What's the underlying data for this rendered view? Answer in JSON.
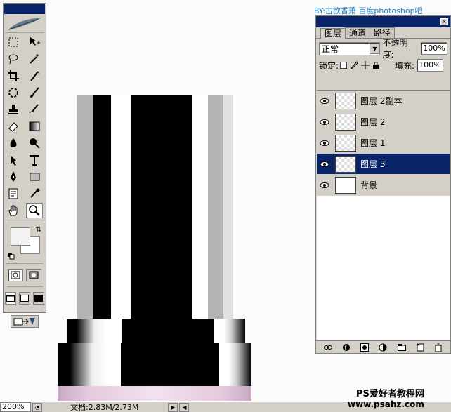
{
  "app": {
    "credit_top": "BY:古欲香萧  百度photoshop吧",
    "watermark_line1": "PS爱好者教程网",
    "watermark_line2": "www.psahz.com"
  },
  "toolbox": {
    "tools": [
      "marquee-icon",
      "move-icon",
      "lasso-icon",
      "magic-wand-icon",
      "crop-icon",
      "slice-icon",
      "healing-brush-icon",
      "brush-icon",
      "clone-stamp-icon",
      "history-brush-icon",
      "eraser-icon",
      "gradient-icon",
      "blur-icon",
      "dodge-icon",
      "path-selection-icon",
      "type-icon",
      "pen-icon",
      "rectangle-shape-icon",
      "notes-icon",
      "eyedropper-icon",
      "hand-icon",
      "zoom-icon"
    ],
    "active_tool": "zoom-icon",
    "foreground_color": "#f2f2f2",
    "background_color": "#ffffff"
  },
  "layers_panel": {
    "tabs": [
      "图层",
      "通道",
      "路径"
    ],
    "active_tab": "图层",
    "blend_mode": "正常",
    "opacity_label": "不透明度:",
    "opacity_value": "100%",
    "lock_label": "锁定:",
    "fill_label": "填充:",
    "fill_value": "100%",
    "layers": [
      {
        "name": "图层 2副本",
        "selected": false,
        "transparent": true
      },
      {
        "name": "图层 2",
        "selected": false,
        "transparent": true
      },
      {
        "name": "图层 1",
        "selected": false,
        "transparent": true
      },
      {
        "name": "图层 3",
        "selected": true,
        "transparent": true
      },
      {
        "name": "背景",
        "selected": false,
        "transparent": false
      }
    ]
  },
  "statusbar": {
    "zoom": "200%",
    "doc_info": "文档:2.83M/2.73M"
  }
}
